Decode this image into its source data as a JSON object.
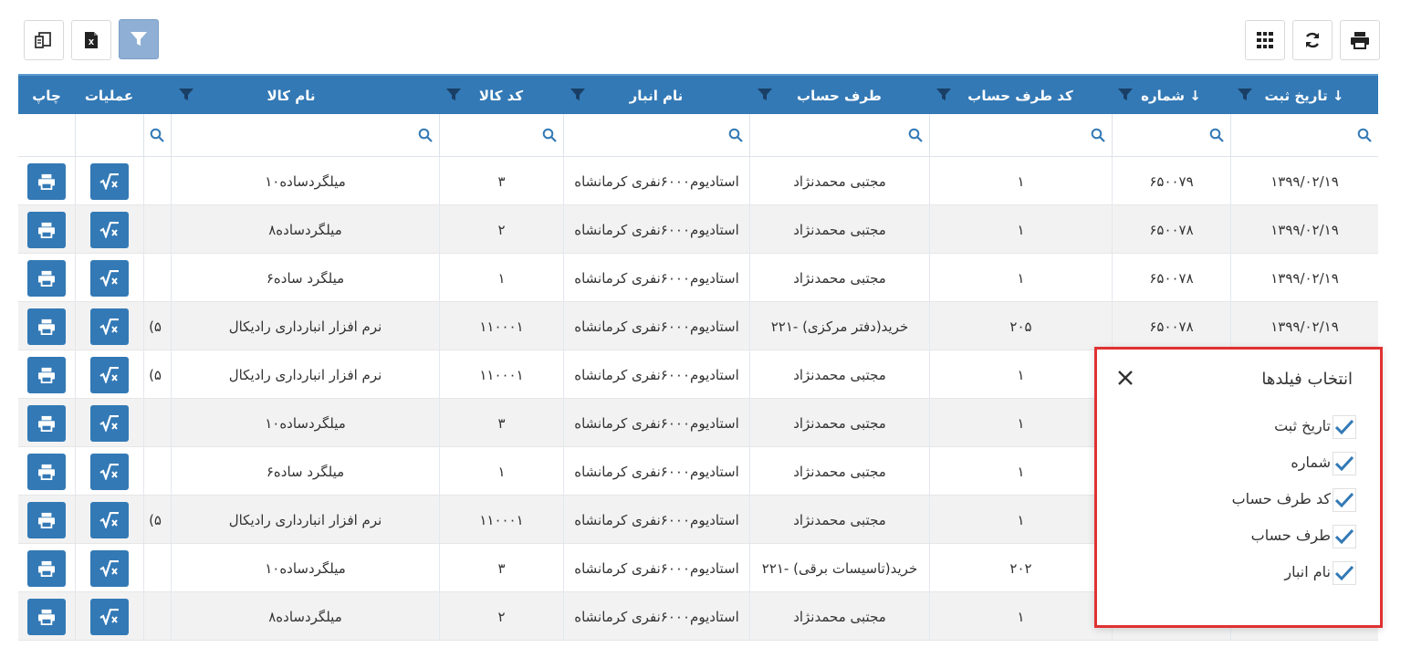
{
  "toolbar": {
    "left": [
      {
        "name": "column-chooser-button",
        "icon": "column-chooser-icon"
      },
      {
        "name": "excel-export-button",
        "icon": "excel-icon"
      },
      {
        "name": "filter-toggle-button",
        "icon": "filter-icon"
      }
    ],
    "right": [
      {
        "name": "grid-layout-button",
        "icon": "grid-icon"
      },
      {
        "name": "refresh-button",
        "icon": "refresh-icon"
      },
      {
        "name": "print-button",
        "icon": "print-icon"
      }
    ]
  },
  "grid": {
    "columns": {
      "date": "تاریخ ثبت ↓",
      "number": "شماره ↓",
      "account_code": "کد طرف حساب",
      "account": "طرف حساب",
      "warehouse": "نام انبار",
      "item_code": "کد کالا",
      "item_name": "نام کالا",
      "ops": "عملیات",
      "print": "چاپ"
    },
    "rows": [
      {
        "date": "۱۳۹۹/۰۲/۱۹",
        "number": "۶۵۰۰۷۹",
        "account_code": "۱",
        "account": "مجتبی محمدنژاد",
        "warehouse": "استادیوم۶۰۰۰نفری کرمانشاه",
        "item_code": "۳",
        "item_name": "میلگردساده۱۰",
        "extra": ""
      },
      {
        "date": "۱۳۹۹/۰۲/۱۹",
        "number": "۶۵۰۰۷۸",
        "account_code": "۱",
        "account": "مجتبی محمدنژاد",
        "warehouse": "استادیوم۶۰۰۰نفری کرمانشاه",
        "item_code": "۲",
        "item_name": "میلگردساده۸",
        "extra": ""
      },
      {
        "date": "۱۳۹۹/۰۲/۱۹",
        "number": "۶۵۰۰۷۸",
        "account_code": "۱",
        "account": "مجتبی محمدنژاد",
        "warehouse": "استادیوم۶۰۰۰نفری کرمانشاه",
        "item_code": "۱",
        "item_name": "میلگرد ساده۶",
        "extra": ""
      },
      {
        "date": "۱۳۹۹/۰۲/۱۹",
        "number": "۶۵۰۰۷۸",
        "account_code": "۲۰۵",
        "account": "۲۲۱- خرید(دفتر مرکزی)",
        "warehouse": "استادیوم۶۰۰۰نفری کرمانشاه",
        "item_code": "۱۱۰۰۰۱",
        "item_name": "نرم افزار انبارداری رادیکال",
        "extra": "(۵"
      },
      {
        "date": "",
        "number": "",
        "account_code": "۱",
        "account": "مجتبی محمدنژاد",
        "warehouse": "استادیوم۶۰۰۰نفری کرمانشاه",
        "item_code": "۱۱۰۰۰۱",
        "item_name": "نرم افزار انبارداری رادیکال",
        "extra": "(۵"
      },
      {
        "date": "",
        "number": "",
        "account_code": "۱",
        "account": "مجتبی محمدنژاد",
        "warehouse": "استادیوم۶۰۰۰نفری کرمانشاه",
        "item_code": "۳",
        "item_name": "میلگردساده۱۰",
        "extra": ""
      },
      {
        "date": "",
        "number": "",
        "account_code": "۱",
        "account": "مجتبی محمدنژاد",
        "warehouse": "استادیوم۶۰۰۰نفری کرمانشاه",
        "item_code": "۱",
        "item_name": "میلگرد ساده۶",
        "extra": ""
      },
      {
        "date": "",
        "number": "",
        "account_code": "۱",
        "account": "مجتبی محمدنژاد",
        "warehouse": "استادیوم۶۰۰۰نفری کرمانشاه",
        "item_code": "۱۱۰۰۰۱",
        "item_name": "نرم افزار انبارداری رادیکال",
        "extra": "(۵"
      },
      {
        "date": "",
        "number": "",
        "account_code": "۲۰۲",
        "account": "۲۲۱- خرید(تاسیسات برقی)",
        "warehouse": "استادیوم۶۰۰۰نفری کرمانشاه",
        "item_code": "۳",
        "item_name": "میلگردساده۱۰",
        "extra": ""
      },
      {
        "date": "",
        "number": "",
        "account_code": "۱",
        "account": "مجتبی محمدنژاد",
        "warehouse": "استادیوم۶۰۰۰نفری کرمانشاه",
        "item_code": "۲",
        "item_name": "میلگردساده۸",
        "extra": ""
      }
    ]
  },
  "column_chooser": {
    "title": "انتخاب فیلدها",
    "options": [
      "تاریخ ثبت",
      "شماره",
      "کد طرف حساب",
      "طرف حساب",
      "نام انبار"
    ]
  },
  "colors": {
    "header": "#3379b5",
    "button": "#3379b5",
    "popup_border": "#e03131",
    "check": "#3379b5"
  }
}
